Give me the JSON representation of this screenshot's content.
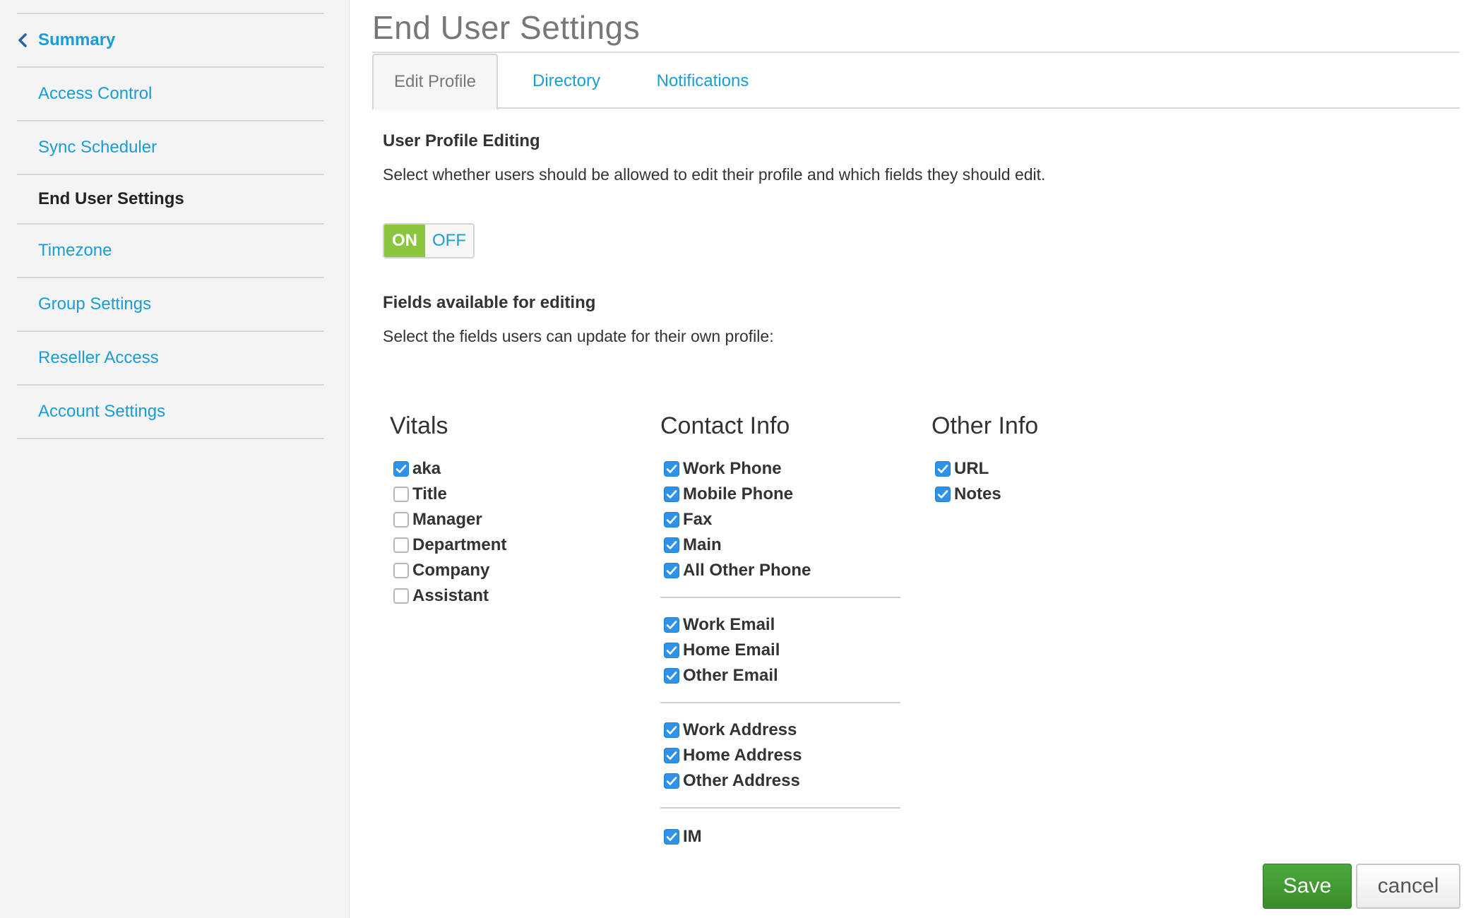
{
  "sidebar": {
    "back_label": "Summary",
    "items": [
      {
        "label": "Access Control"
      },
      {
        "label": "Sync Scheduler"
      },
      {
        "label": "End User Settings"
      },
      {
        "label": "Timezone"
      },
      {
        "label": "Group Settings"
      },
      {
        "label": "Reseller Access"
      },
      {
        "label": "Account Settings"
      }
    ],
    "active_item": "End User Settings"
  },
  "page": {
    "title": "End User Settings"
  },
  "tabs": [
    {
      "label": "Edit Profile",
      "active": true
    },
    {
      "label": "Directory",
      "active": false
    },
    {
      "label": "Notifications",
      "active": false
    }
  ],
  "profile_editing": {
    "heading": "User Profile Editing",
    "description": "Select whether users should be allowed to edit their profile and which fields they should edit.",
    "toggle": {
      "on_label": "ON",
      "off_label": "OFF",
      "value": "ON"
    }
  },
  "fields": {
    "heading": "Fields available for editing",
    "description": "Select the fields users can update for their own profile:",
    "columns": {
      "vitals": {
        "title": "Vitals",
        "items": [
          {
            "label": "aka",
            "checked": true
          },
          {
            "label": "Title",
            "checked": false
          },
          {
            "label": "Manager",
            "checked": false
          },
          {
            "label": "Department",
            "checked": false
          },
          {
            "label": "Company",
            "checked": false
          },
          {
            "label": "Assistant",
            "checked": false
          }
        ]
      },
      "contact": {
        "title": "Contact Info",
        "phones": [
          {
            "label": "Work Phone",
            "checked": true
          },
          {
            "label": "Mobile Phone",
            "checked": true
          },
          {
            "label": "Fax",
            "checked": true
          },
          {
            "label": "Main",
            "checked": true
          },
          {
            "label": "All Other Phone",
            "checked": true
          }
        ],
        "emails": [
          {
            "label": "Work Email",
            "checked": true
          },
          {
            "label": "Home Email",
            "checked": true
          },
          {
            "label": "Other Email",
            "checked": true
          }
        ],
        "addresses": [
          {
            "label": "Work Address",
            "checked": true
          },
          {
            "label": "Home Address",
            "checked": true
          },
          {
            "label": "Other Address",
            "checked": true
          }
        ],
        "im": [
          {
            "label": "IM",
            "checked": true
          }
        ]
      },
      "other": {
        "title": "Other Info",
        "items": [
          {
            "label": "URL",
            "checked": true
          },
          {
            "label": "Notes",
            "checked": true
          }
        ]
      }
    }
  },
  "actions": {
    "save_label": "Save",
    "cancel_label": "cancel"
  },
  "colors": {
    "link": "#1a9cd6",
    "toggle_on": "#8cc63f",
    "checkbox": "#2e93e8",
    "save_button": "#4ca93c"
  }
}
